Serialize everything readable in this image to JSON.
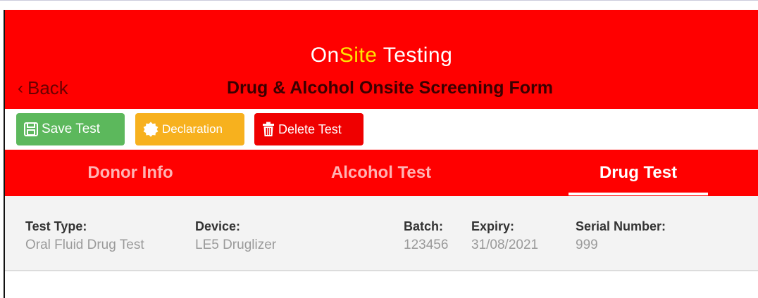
{
  "header": {
    "brand": {
      "part1": "On",
      "part2": "Site",
      "part3": " Testing"
    },
    "back_label": "Back",
    "form_title": "Drug & Alcohol Onsite Screening Form"
  },
  "toolbar": {
    "save_label": "Save Test",
    "declaration_label": "Declaration",
    "delete_label": "Delete Test"
  },
  "tabs": [
    {
      "label": "Donor Info",
      "active": false
    },
    {
      "label": "Alcohol Test",
      "active": false
    },
    {
      "label": "Drug Test",
      "active": true
    }
  ],
  "test_info": {
    "test_type": {
      "label": "Test Type:",
      "value": "Oral Fluid Drug Test"
    },
    "device": {
      "label": "Device:",
      "value": "LE5 Druglizer"
    },
    "batch": {
      "label": "Batch:",
      "value": "123456"
    },
    "expiry": {
      "label": "Expiry:",
      "value": "31/08/2021"
    },
    "serial": {
      "label": "Serial Number:",
      "value": "999"
    }
  },
  "colors": {
    "header_red": "#ff0000",
    "brand_yellow": "#ffe400",
    "save_green": "#5cb85c",
    "declaration_orange": "#f7b11e",
    "delete_red": "#ef0000"
  },
  "icons": {
    "back": "chevron-left-icon",
    "save": "floppy-disk-icon",
    "declaration": "badge-icon",
    "delete": "trash-icon"
  }
}
